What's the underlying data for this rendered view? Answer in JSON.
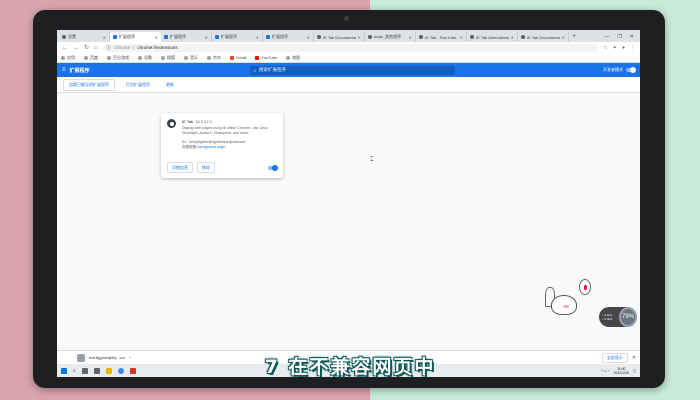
{
  "browser": {
    "tabs": [
      {
        "label": "设置",
        "active": false
      },
      {
        "label": "扩展程序",
        "active": true
      },
      {
        "label": "扩展程序",
        "active": false
      },
      {
        "label": "扩展程序",
        "active": false
      },
      {
        "label": "扩展程序",
        "active": false
      },
      {
        "label": "IE Tab Documentati...",
        "active": false
      },
      {
        "label": "edab_其他程序",
        "active": false
      },
      {
        "label": "IE Tab - Run Inter...",
        "active": false
      },
      {
        "label": "IE Tab Alternatives",
        "active": false
      },
      {
        "label": "IE Tab Documentati...",
        "active": false
      }
    ],
    "new_tab": "+",
    "window_controls": [
      "—",
      "❐",
      "✕"
    ],
    "address": {
      "scheme": "Chrome",
      "separator": "|",
      "url": "chrome://extensions"
    },
    "bookmarks": [
      "应用",
      "百度",
      "百分游戏",
      "谷歌",
      "搜狐",
      "音乐",
      "京东",
      "Gmail",
      "YouTube",
      "地图"
    ]
  },
  "extensions_page": {
    "title": "扩展程序",
    "search_placeholder": "搜索扩展程序",
    "dev_mode_label": "开发者模式",
    "actions": [
      "加载已解压的扩展程序",
      "打包扩展程序",
      "更新"
    ],
    "card": {
      "name": "IE Tab",
      "version": "16.3.22.1",
      "description": "Display web pages using IE within Chrome. Use Java, Silverlight, ActiveX, Sharepoint, and more.",
      "id_label": "ID：hehijbfgiekmjfkfjpbkbammjbdenadd",
      "inspect_label": "查看视图",
      "inspect_link": "background page",
      "details_button": "详细信息",
      "remove_button": "移除",
      "enabled": true
    }
  },
  "download_bar": {
    "file": "bxfukjjgnekjfdbj...crx",
    "caret": "^",
    "show_all": "全部显示",
    "close": "✕",
    "badge": "53.6k/s"
  },
  "speed_widget": {
    "up": "↑ 0.1k/s",
    "down": "↓ 0.4k/s",
    "percent": "79%"
  },
  "taskbar": {
    "time": "11:00",
    "date": "2021/1/26"
  },
  "caption": "7 在不兼容网页中"
}
